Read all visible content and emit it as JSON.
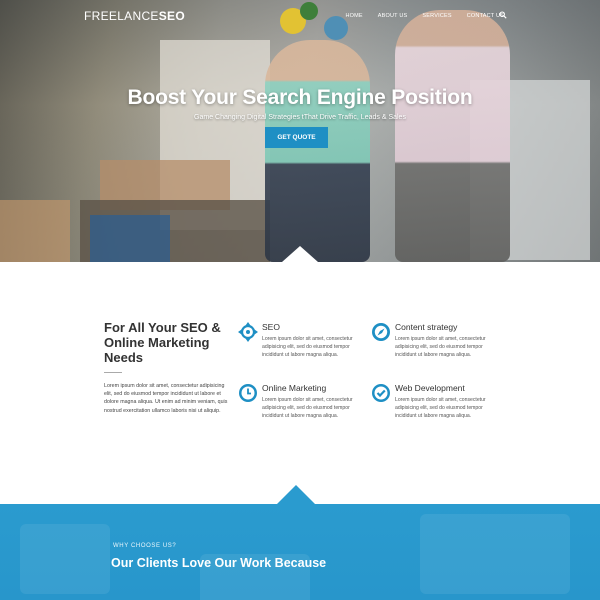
{
  "nav": {
    "logo_light": "FREELANCE",
    "logo_bold": "SEO",
    "items": [
      "HOME",
      "ABOUT US",
      "SERVICES",
      "CONTACT US"
    ],
    "search_icon": "search-icon"
  },
  "hero": {
    "title": "Boost Your Search Engine Position",
    "subtitle": "Game Changing Digital Strategies tThat Drive Traffic, Leads & Sales",
    "cta_label": "GET QUOTE"
  },
  "services": {
    "heading": "For All Your SEO & Online Marketing Needs",
    "intro": "Lorem ipsum dolor sit amet, consectetur adipisicing elit, sed do eiusmod tempor incididunt ut labore et dolore magna aliqua. Ut enim ad minim veniam, quis nostrud exercitation ullamco laboris nisi ut aliquip.",
    "features": [
      {
        "title": "SEO",
        "icon": "crosshair-icon",
        "body": "Lorem ipsum dolor sit amet, consectetur adipisicing elit, sed do eiusmod tempor incididunt ut labore magna aliqua."
      },
      {
        "title": "Content strategy",
        "icon": "compass-icon",
        "body": "Lorem ipsum dolor sit amet, consectetur adipisicing elit, sed do eiusmod tempor incididunt ut labore magna aliqua."
      },
      {
        "title": "Online Marketing",
        "icon": "clock-icon",
        "body": "Lorem ipsum dolor sit amet, consectetur adipisicing elit, sed do eiusmod tempor incididunt ut labore magna aliqua."
      },
      {
        "title": "Web Development",
        "icon": "checkmark-icon",
        "body": "Lorem ipsum dolor sit amet, consectetur adipisicing elit, sed do eiusmod tempor incididunt ut labore magna aliqua."
      }
    ]
  },
  "why": {
    "kicker": "WHY CHOOSE US?",
    "title": "Our Clients Love Our Work Because"
  },
  "colors": {
    "accent": "#1e8fc4",
    "band": "#2a9bcf"
  }
}
